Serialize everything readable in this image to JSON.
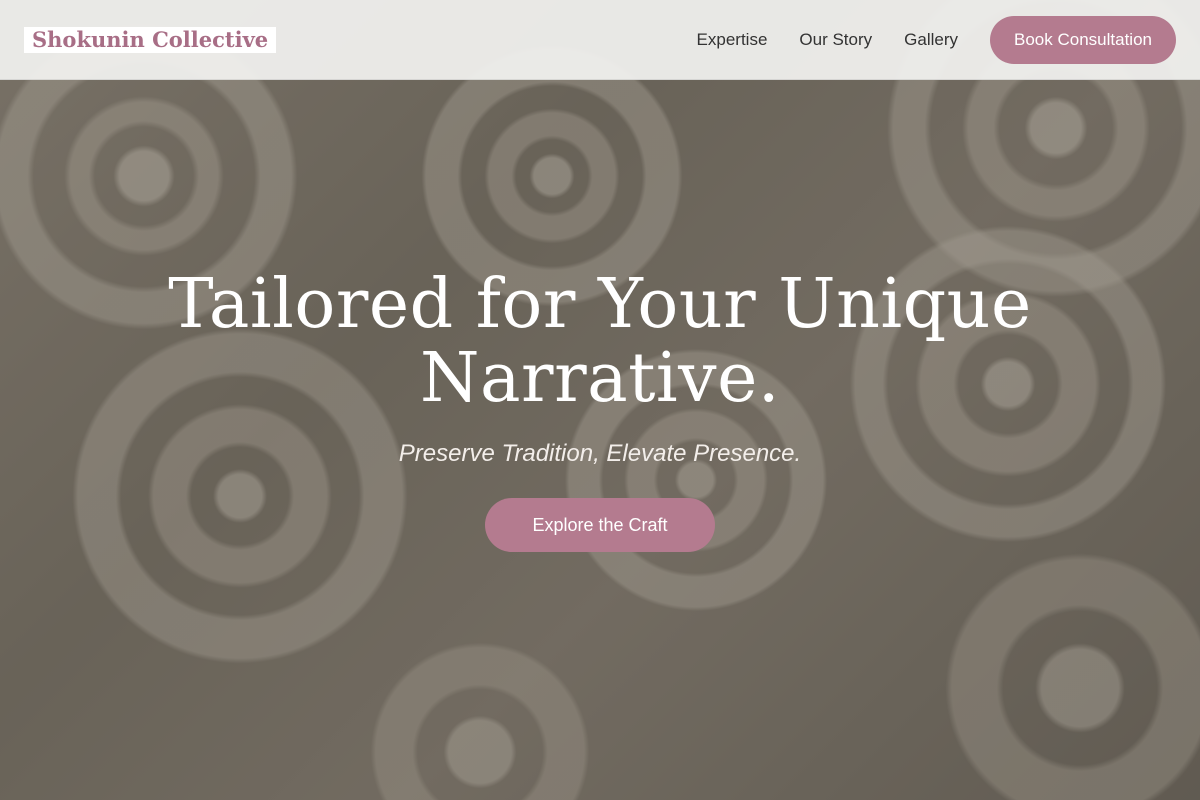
{
  "brand": {
    "name": "Shokunin Collective",
    "color": "#a86e86"
  },
  "nav": {
    "links": [
      {
        "label": "Expertise"
      },
      {
        "label": "Our Story"
      },
      {
        "label": "Gallery"
      }
    ],
    "cta_label": "Book Consultation"
  },
  "hero": {
    "headline": "Tailored for Your Unique Narrative.",
    "tagline": "Preserve Tradition, Elevate Presence.",
    "cta_label": "Explore the Craft",
    "background_image": "rolled-fabric-photo"
  },
  "colors": {
    "accent": "#b47b8f",
    "header_bg": "#f2f2f0",
    "text_light": "#ffffff"
  }
}
